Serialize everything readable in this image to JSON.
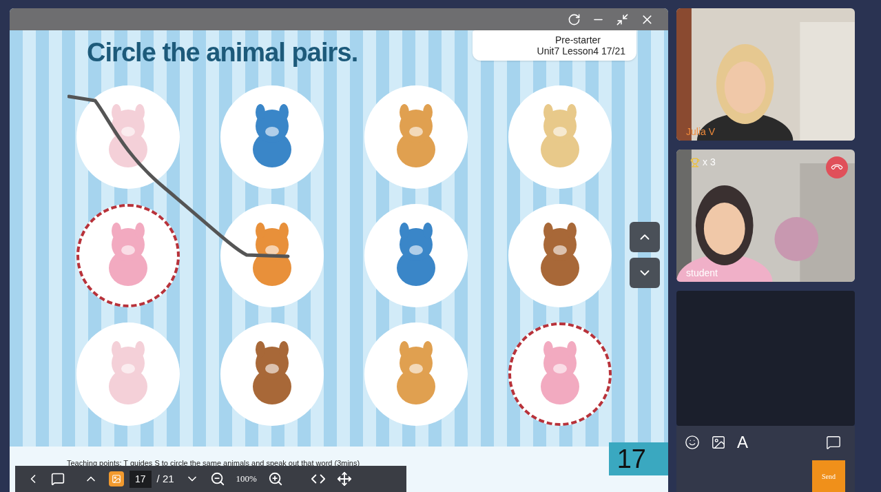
{
  "slide": {
    "title": "Circle the animal pairs.",
    "level_name": "Pre-starter",
    "lesson": "Unit7 Lesson4 17/21",
    "animals": [
      {
        "kind": "rabbit",
        "circled": false
      },
      {
        "kind": "bird",
        "circled": false
      },
      {
        "kind": "cat",
        "circled": false
      },
      {
        "kind": "dog",
        "circled": false
      },
      {
        "kind": "pig",
        "circled": true
      },
      {
        "kind": "fox",
        "circled": false
      },
      {
        "kind": "bird",
        "circled": false
      },
      {
        "kind": "monkey",
        "circled": false
      },
      {
        "kind": "rabbit",
        "circled": false
      },
      {
        "kind": "monkey",
        "circled": false
      },
      {
        "kind": "cat",
        "circled": false
      },
      {
        "kind": "pig",
        "circled": true
      }
    ],
    "teaching_points": "Teaching points: T guides S to circle the same animals and speak out that word (3mins)",
    "page_badge": "17"
  },
  "toolbar": {
    "page": "17",
    "total": "/ 21",
    "zoom": "100%"
  },
  "videos": [
    {
      "name": "Julia V",
      "kind": "teacher"
    },
    {
      "name": "student",
      "kind": "student",
      "trophies": "x 3"
    }
  ],
  "chat": {
    "font_button": "A",
    "send": "Send"
  }
}
